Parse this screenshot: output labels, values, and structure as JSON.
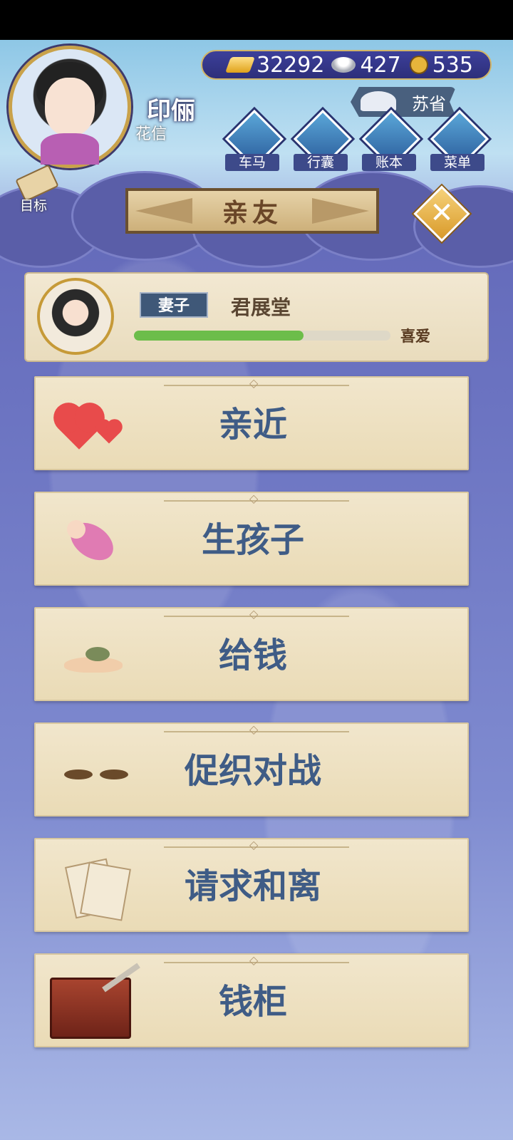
{
  "player": {
    "name": "印俪",
    "title": "花信"
  },
  "currencies": {
    "gold": "32292",
    "silver": "427",
    "coin": "535"
  },
  "region": {
    "label": "苏省"
  },
  "nav": [
    {
      "label": "车马"
    },
    {
      "label": "行囊"
    },
    {
      "label": "账本"
    },
    {
      "label": "菜单"
    }
  ],
  "target": {
    "label": "目标"
  },
  "page": {
    "title": "亲友",
    "close": "✕"
  },
  "spouse": {
    "tag": "妻子",
    "name": "君展堂",
    "relation": "喜爱",
    "affection": 0.66
  },
  "actions": [
    {
      "label": "亲近",
      "icon": "hearts-icon"
    },
    {
      "label": "生孩子",
      "icon": "baby-icon"
    },
    {
      "label": "给钱",
      "icon": "money-hand-icon"
    },
    {
      "label": "促织对战",
      "icon": "cricket-icon"
    },
    {
      "label": "请求和离",
      "icon": "divorce-letter-icon"
    },
    {
      "label": "钱柜",
      "icon": "chest-key-icon"
    }
  ]
}
